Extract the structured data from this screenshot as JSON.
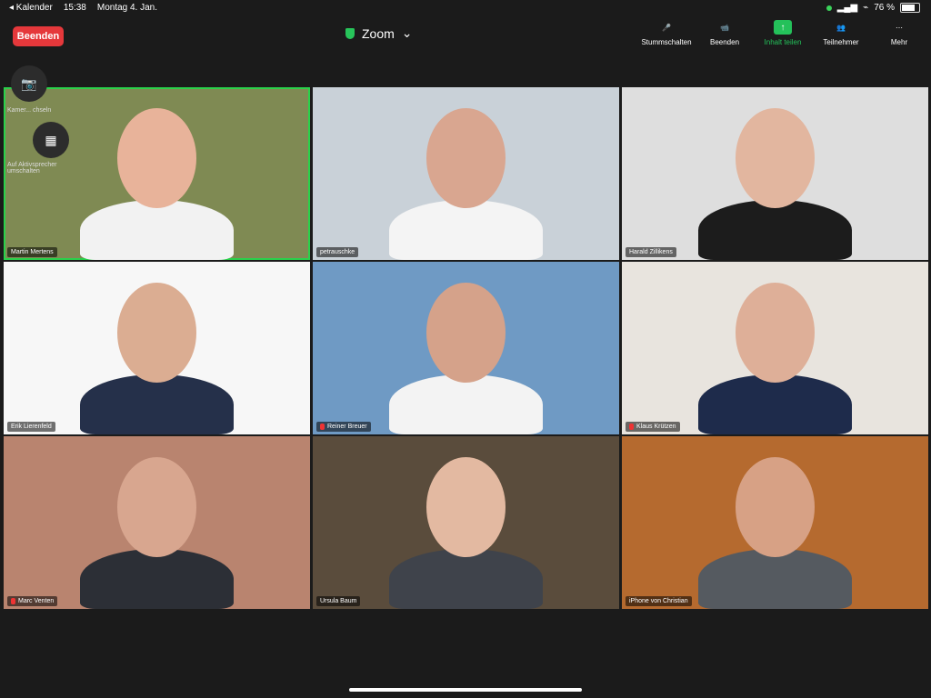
{
  "status": {
    "back_label": "◂ Kalender",
    "time": "15:38",
    "date": "Montag 4. Jan.",
    "battery": "76 %",
    "battery_level": 0.76
  },
  "topbar": {
    "end_label": "Beenden",
    "app_title": "Zoom",
    "controls": [
      {
        "label": "Stummschalten",
        "icon": "mic-icon"
      },
      {
        "label": "Beenden",
        "icon": "video-icon"
      },
      {
        "label": "Inhalt teilen",
        "icon": "share-icon"
      },
      {
        "label": "Teilnehmer",
        "icon": "participants-icon"
      },
      {
        "label": "Mehr",
        "icon": "more-icon"
      }
    ]
  },
  "self_view": {
    "camera_switch_label": "Kamer... chseln",
    "active_speaker_label": "Auf Aktivsprecher umschalten"
  },
  "participants": [
    {
      "name": "Martin Mertens",
      "muted": false,
      "active": true,
      "bg": "#7f8a53",
      "shirt": "#f2f2f2",
      "face": "#e8b39a"
    },
    {
      "name": "petrauschke",
      "muted": false,
      "active": false,
      "bg": "#c9d1d8",
      "shirt": "#f4f4f4",
      "face": "#d9a690"
    },
    {
      "name": "Harald Zillikens",
      "muted": false,
      "active": false,
      "bg": "#dedede",
      "shirt": "#1c1c1c",
      "face": "#e2b69f"
    },
    {
      "name": "Erik Lierenfeld",
      "muted": false,
      "active": false,
      "bg": "#f7f7f7",
      "shirt": "#25304a",
      "face": "#dbad92"
    },
    {
      "name": "Reiner Breuer",
      "muted": true,
      "active": false,
      "bg": "#6f9ac4",
      "shirt": "#f3f3f3",
      "face": "#d5a28a"
    },
    {
      "name": "Klaus Krützen",
      "muted": true,
      "active": false,
      "bg": "#e8e4de",
      "shirt": "#1e2b4b",
      "face": "#deaf98"
    },
    {
      "name": "Marc Venten",
      "muted": true,
      "active": false,
      "bg": "#b9846f",
      "shirt": "#2c2f36",
      "face": "#d8a68f"
    },
    {
      "name": "Ursula Baum",
      "muted": false,
      "active": false,
      "bg": "#5a4c3c",
      "shirt": "#3f434b",
      "face": "#e3b9a1"
    },
    {
      "name": "iPhone von Christian",
      "muted": false,
      "active": false,
      "bg": "#b56a2f",
      "shirt": "#555a60",
      "face": "#d7a185"
    }
  ]
}
